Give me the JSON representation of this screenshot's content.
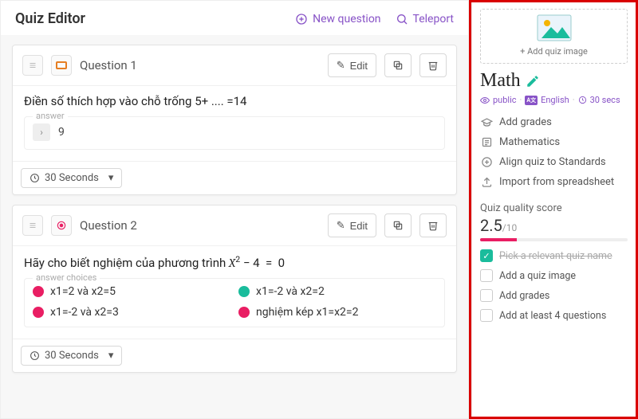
{
  "header": {
    "title": "Quiz Editor",
    "new_question": "New question",
    "teleport": "Teleport"
  },
  "questions": [
    {
      "title": "Question 1",
      "edit": "Edit",
      "prompt": "Điền số thích hợp vào chỗ trống 5+ .... =14",
      "answer_legend": "answer",
      "answer_value": "9",
      "timer": "30 Seconds"
    },
    {
      "title": "Question 2",
      "edit": "Edit",
      "prompt_prefix": "Hãy cho biết nghiệm của phương trình ",
      "prompt_math": "X² − 4 = 0",
      "choices_legend": "answer choices",
      "choices": [
        {
          "text": "x1=2 và x2=5",
          "color": "pink"
        },
        {
          "text": "x1=-2 và x2=2",
          "color": "green"
        },
        {
          "text": "x1=-2 và x2=3",
          "color": "pink"
        },
        {
          "text": "nghiệm kép x1=x2=2",
          "color": "pink"
        }
      ],
      "timer": "30 Seconds"
    }
  ],
  "side": {
    "add_image": "+ Add quiz image",
    "quiz_name": "Math",
    "meta_visibility": "public",
    "meta_language": "English",
    "meta_duration": "30 secs",
    "items": {
      "grades": "Add grades",
      "subject": "Mathematics",
      "standards": "Align quiz to Standards",
      "import": "Import from spreadsheet"
    },
    "quality_label": "Quiz quality score",
    "quality_score": "2.5",
    "quality_max": "/10",
    "checks": [
      {
        "label": "Pick a relevant quiz name",
        "done": true
      },
      {
        "label": "Add a quiz image",
        "done": false
      },
      {
        "label": "Add grades",
        "done": false
      },
      {
        "label": "Add at least 4 questions",
        "done": false
      }
    ]
  }
}
